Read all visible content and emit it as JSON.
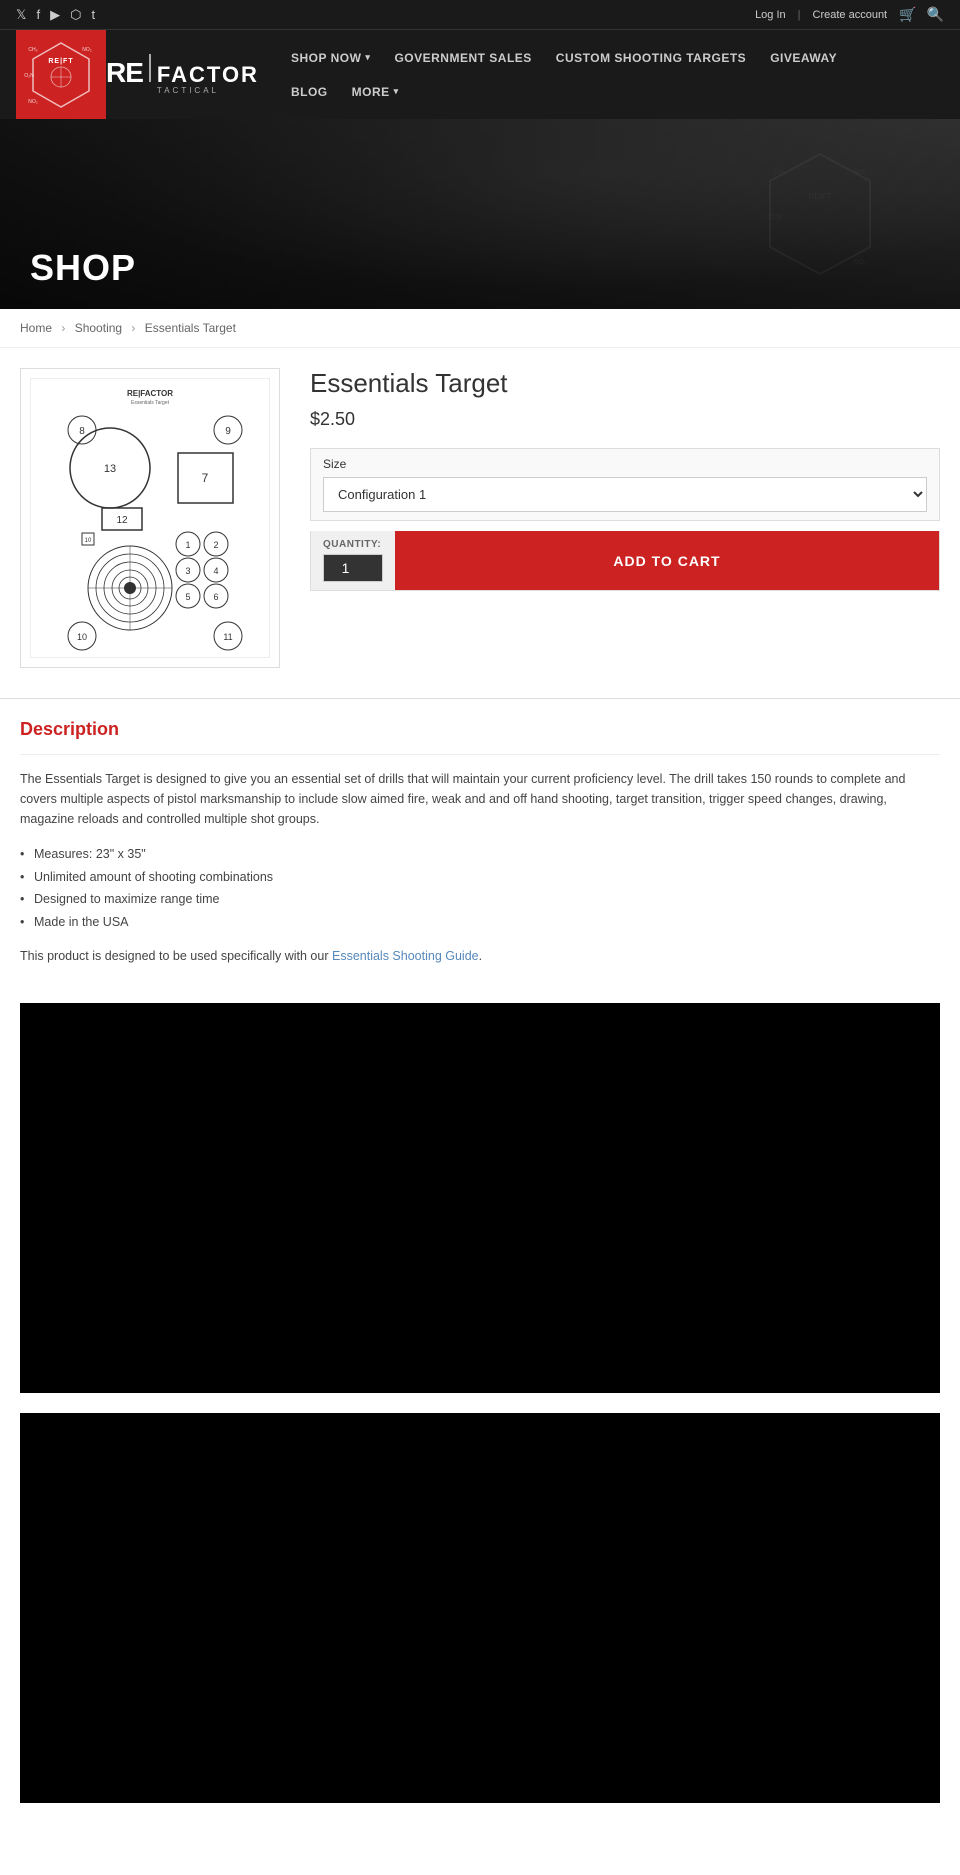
{
  "topbar": {
    "social_icons": [
      "twitter",
      "facebook",
      "youtube",
      "instagram",
      "tumblr"
    ],
    "login_label": "Log In",
    "create_account_label": "Create account",
    "separator": "|"
  },
  "nav": {
    "logo_re": "RE",
    "logo_factor": "FACTOR",
    "logo_pipe": "|",
    "logo_tactical": "TACTICAL",
    "items": [
      {
        "label": "SHOP NOW",
        "has_dropdown": true
      },
      {
        "label": "GOVERNMENT SALES",
        "has_dropdown": false
      },
      {
        "label": "CUSTOM SHOOTING TARGETS",
        "has_dropdown": false
      },
      {
        "label": "GIVEAWAY",
        "has_dropdown": false
      },
      {
        "label": "BLOG",
        "has_dropdown": false
      },
      {
        "label": "MORE",
        "has_dropdown": true
      }
    ]
  },
  "hero": {
    "title": "SHOP"
  },
  "breadcrumb": {
    "home": "Home",
    "shooting": "Shooting",
    "current": "Essentials Target",
    "sep": "›"
  },
  "product": {
    "title": "Essentials Target",
    "price": "$2.50",
    "size_label": "Size",
    "size_value": "Configuration 1",
    "quantity_label": "QUANTITY:",
    "quantity_value": "1",
    "add_to_cart": "ADD TO CART"
  },
  "description": {
    "heading": "Description",
    "body": "The Essentials Target is designed to give you an essential set of drills that will maintain your current proficiency level. The drill takes 150 rounds to complete and covers multiple aspects of pistol marksmanship to include slow aimed fire, weak and and off hand shooting, target transition, trigger speed changes, drawing, magazine reloads and controlled multiple shot groups.",
    "bullets": [
      "Measures: 23\" x 35\"",
      "Unlimited amount of shooting combinations",
      "Designed to maximize range time",
      "Made in the USA"
    ],
    "note_prefix": "This product is designed to be used specifically with our ",
    "note_link": "Essentials Shooting Guide",
    "note_suffix": "."
  }
}
